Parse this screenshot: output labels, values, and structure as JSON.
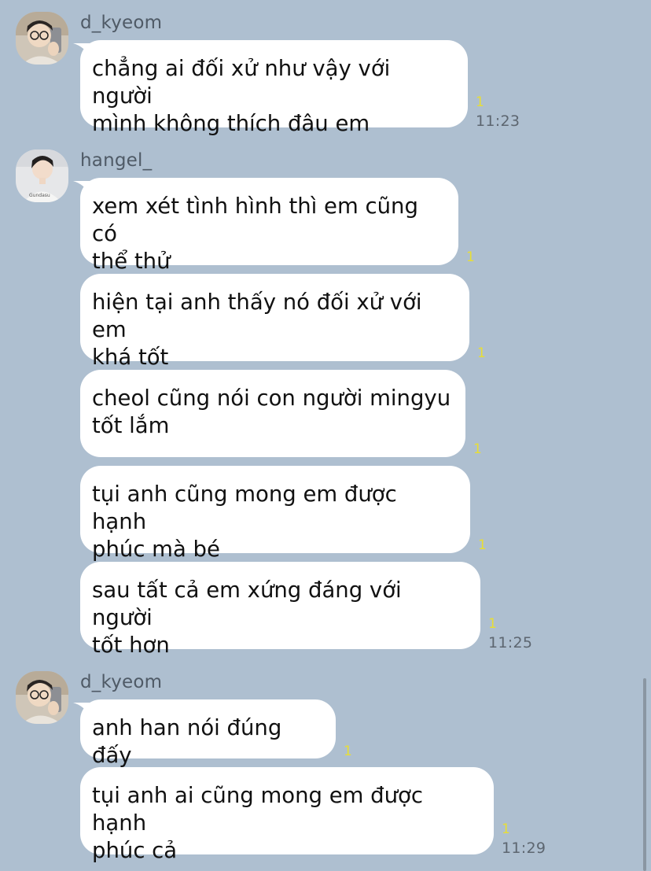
{
  "groups": [
    {
      "sender": "d_kyeom",
      "avatar": "avatar-d-kyeom",
      "messages": [
        {
          "text": "chẳng ai đối xử như vậy với người\nmình không thích đâu em",
          "read": "1",
          "time": "11:23"
        }
      ]
    },
    {
      "sender": "hangel_",
      "avatar": "avatar-hangel",
      "messages": [
        {
          "text": "xem xét tình hình thì em cũng có\nthể thử",
          "read": "1",
          "time": ""
        },
        {
          "text": "hiện tại anh thấy nó đối xử với em\nkhá tốt",
          "read": "1",
          "time": ""
        },
        {
          "text": "cheol cũng nói con người mingyu\ntốt lắm",
          "read": "1",
          "time": ""
        },
        {
          "text": "tụi anh cũng mong em được hạnh\nphúc mà bé",
          "read": "1",
          "time": ""
        },
        {
          "text": "sau tất cả em xứng đáng với người\ntốt hơn",
          "read": "1",
          "time": "11:25"
        }
      ]
    },
    {
      "sender": "d_kyeom",
      "avatar": "avatar-d-kyeom",
      "messages": [
        {
          "text": "anh han nói đúng đấy",
          "read": "1",
          "time": ""
        },
        {
          "text": "tụi anh ai cũng mong em được hạnh\nphúc cả",
          "read": "1",
          "time": "11:29"
        }
      ]
    }
  ],
  "colors": {
    "background": "#aebfd0",
    "bubble": "#ffffff",
    "read_indicator": "#e8de34",
    "time": "#5d6670",
    "sender": "#4f5a66"
  }
}
